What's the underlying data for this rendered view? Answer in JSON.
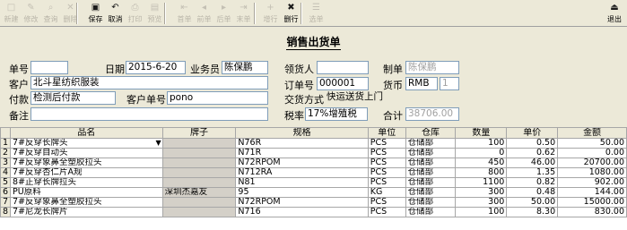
{
  "toolbar": {
    "left": [
      {
        "label": "新建",
        "icon": "new-icon",
        "enabled": false
      },
      {
        "label": "修改",
        "icon": "edit-icon",
        "enabled": false
      },
      {
        "label": "查询",
        "icon": "query-icon",
        "enabled": false
      },
      {
        "label": "删除",
        "icon": "delete-icon",
        "enabled": false
      },
      {
        "label": "保存",
        "icon": "save-icon",
        "enabled": true
      },
      {
        "label": "取消",
        "icon": "cancel-icon",
        "enabled": true
      },
      {
        "label": "打印",
        "icon": "print-icon",
        "enabled": false
      },
      {
        "label": "预览",
        "icon": "preview-icon",
        "enabled": false
      },
      {
        "label": "首单",
        "icon": "first-icon",
        "enabled": false
      },
      {
        "label": "前单",
        "icon": "prev-icon",
        "enabled": false
      },
      {
        "label": "后单",
        "icon": "next-icon",
        "enabled": false
      },
      {
        "label": "末单",
        "icon": "last-icon",
        "enabled": false
      },
      {
        "label": "增行",
        "icon": "add-row-icon",
        "enabled": false
      },
      {
        "label": "删行",
        "icon": "delete-row-icon",
        "enabled": true
      },
      {
        "label": "选单",
        "icon": "select-icon",
        "enabled": false
      }
    ],
    "exit_label": "退出"
  },
  "title": "销售出货单",
  "form": {
    "doc_no_label": "单号",
    "doc_no": "",
    "date_label": "日期",
    "date": "2015-6-20",
    "salesman_label": "业务员",
    "salesman": "陈保鹏",
    "receiver_label": "领货人",
    "receiver": "",
    "maker_label": "制单",
    "maker": "陈保鹏",
    "customer_label": "客户",
    "customer": "北斗星纺织服装",
    "order_no_label": "订单号",
    "order_no": "000001",
    "currency_label": "货币",
    "currency": "RMB",
    "rate": "1",
    "payment_label": "付款",
    "payment": "检测后付款",
    "cust_no_label": "客户单号",
    "cust_no": "pono",
    "delivery_label": "交货方式",
    "delivery": "快运送货上门",
    "remark_label": "备注",
    "remark": "",
    "tax_label": "税率",
    "tax": "17%增殖税",
    "total_label": "合计",
    "total": "38706.00"
  },
  "grid": {
    "headers": [
      "",
      "品名",
      "牌子",
      "规格",
      "单位",
      "仓库",
      "数量",
      "单价",
      "金额"
    ],
    "rows": [
      [
        "1",
        "7#反穿长牌头",
        "",
        "N76R",
        "PCS",
        "仓储部",
        "100",
        "0.50",
        "50.00"
      ],
      [
        "2",
        "7#反穿自动头",
        "",
        "N71R",
        "PCS",
        "仓储部",
        "0",
        "0.62",
        "0.00"
      ],
      [
        "3",
        "7#反穿象鼻全塑胶拉头",
        "",
        "N72RPOM",
        "PCS",
        "仓储部",
        "450",
        "46.00",
        "20700.00"
      ],
      [
        "4",
        "7#反穿杏仁片A规",
        "",
        "N712RA",
        "PCS",
        "仓储部",
        "800",
        "1.35",
        "1080.00"
      ],
      [
        "5",
        "8#正穿长牌拉头",
        "",
        "N81",
        "PCS",
        "仓储部",
        "1100",
        "0.82",
        "902.00"
      ],
      [
        "6",
        "PU原料",
        "深圳杰嘉友",
        "95",
        "KG",
        "仓储部",
        "300",
        "0.48",
        "144.00"
      ],
      [
        "7",
        "7#反穿象鼻全塑胶拉头",
        "",
        "N72RPOM",
        "PCS",
        "仓储部",
        "300",
        "50.00",
        "15000.00"
      ],
      [
        "8",
        "7#尼龙长牌片",
        "",
        "N716",
        "PCS",
        "仓储部",
        "100",
        "8.30",
        "830.00"
      ]
    ]
  }
}
